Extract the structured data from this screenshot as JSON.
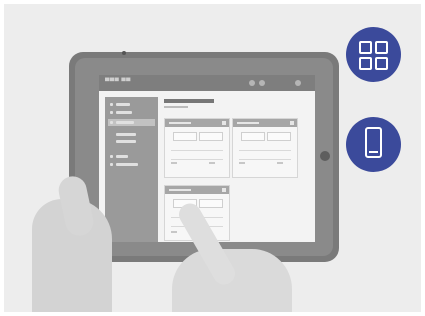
{
  "colors": {
    "icon_circle": "#3b4a9b",
    "icon_glyph": "#ffffff",
    "background": "#ededed"
  },
  "icons": {
    "top": "grid-icon",
    "bottom": "smartphone-icon"
  }
}
